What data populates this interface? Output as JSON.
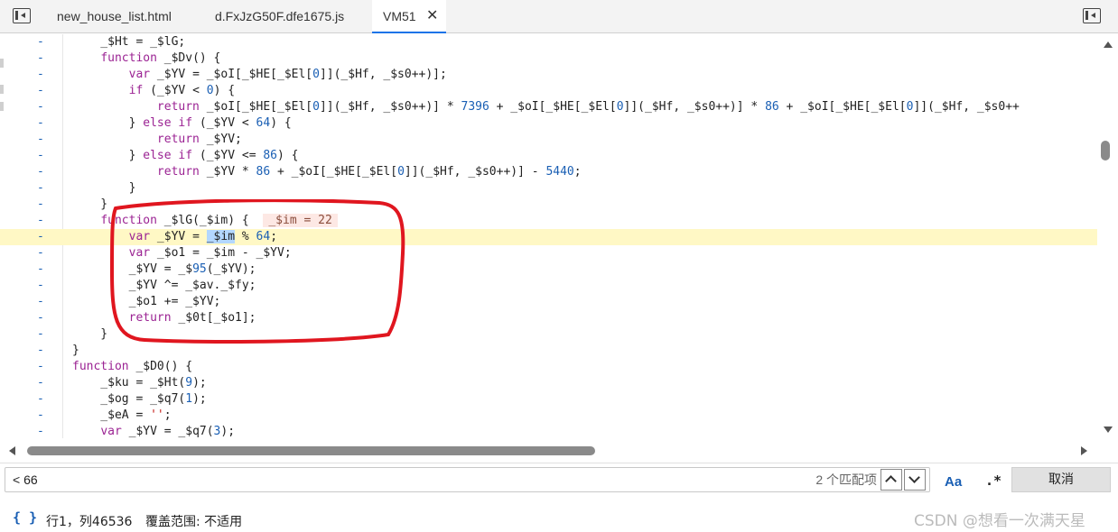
{
  "tabs": [
    {
      "label": "new_house_list.html"
    },
    {
      "label": "d.FxJzG50F.dfe1675.js"
    },
    {
      "label": "VM51",
      "close_glyph": "✕",
      "active": true
    }
  ],
  "icons": {
    "sidebar_toggle": "panel-left-icon",
    "right_toggle": "panel-right-icon",
    "close": "close-icon",
    "coverage": "braces-icon"
  },
  "gutter_dash": "-",
  "code": {
    "inline_value": "_$im = 22",
    "lines": [
      "    _$Ht = _$lG;",
      "    function _$Dv() {",
      "        var _$YV = _$oI[_$HE[_$El[0]](_$Hf, _$s0++)];",
      "        if (_$YV < 0) {",
      "            return _$oI[_$HE[_$El[0]](_$Hf, _$s0++)] * 7396 + _$oI[_$HE[_$El[0]](_$Hf, _$s0++)] * 86 + _$oI[_$HE[_$El[0]](_$Hf, _$s0++",
      "        } else if (_$YV < 64) {",
      "            return _$YV;",
      "        } else if (_$YV <= 86) {",
      "            return _$YV * 86 + _$oI[_$HE[_$El[0]](_$Hf, _$s0++)] - 5440;",
      "        }",
      "    }",
      "    function _$lG(_$im) {",
      "        var _$YV = _$im % 64;",
      "        var _$o1 = _$im - _$YV;",
      "        _$YV = _$95(_$YV);",
      "        _$YV ^= _$av._$fy;",
      "        _$o1 += _$YV;",
      "        return _$0t[_$o1];",
      "    }",
      "}",
      "function _$D0() {",
      "    _$ku = _$Ht(9);",
      "    _$og = _$q7(1);",
      "    _$eA = '';",
      "    var _$YV = _$q7(3);"
    ]
  },
  "search": {
    "query": "< 66",
    "match_count": "2 个匹配项",
    "case_label": "Aa",
    "regex_label": ".*",
    "cancel_label": "取消"
  },
  "status": {
    "braces": "{ }",
    "position": "行1，列46536",
    "coverage": "覆盖范围: 不适用",
    "watermark": "CSDN @想看一次满天星"
  },
  "colors": {
    "keyword": "#9b2393",
    "number": "#1a5fb4",
    "string": "#c41a16",
    "exec_line_bg": "#fff8c5",
    "selection_bg": "#b3d7ff",
    "annotation_red": "#e0161f",
    "active_tab_underline": "#1a73e8"
  }
}
